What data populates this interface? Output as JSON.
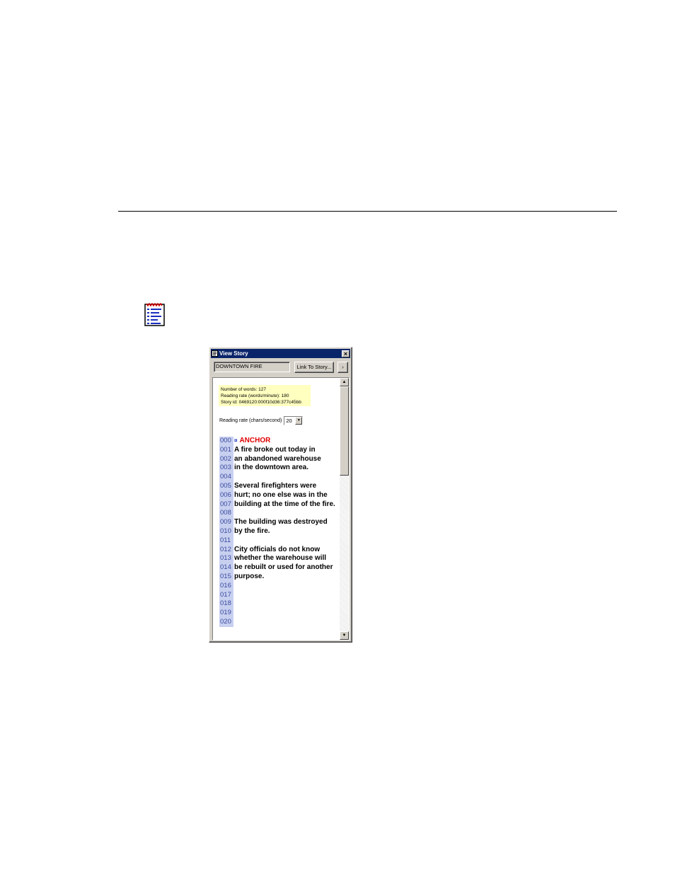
{
  "window": {
    "title": "View Story",
    "close_label": "×",
    "slug": "DOWNTOWN FIRE",
    "link_button": "Link To Story...",
    "next_button": "›"
  },
  "info": {
    "words": "Number of words: 127",
    "rate": "Reading rate (words/minute): 180",
    "story_id": "Story id: 0469120:000f10d36:377c45bb"
  },
  "reading_rate": {
    "label": "Reading rate (chars/second)",
    "value": "20"
  },
  "script": {
    "lines": [
      {
        "num": "000",
        "text": "ANCHOR",
        "cue": "¤",
        "anchor": true
      },
      {
        "num": "001",
        "text": "A fire broke out today in"
      },
      {
        "num": "002",
        "text": "an abandoned warehouse"
      },
      {
        "num": "003",
        "text": "in the downtown area."
      },
      {
        "num": "004",
        "text": ""
      },
      {
        "num": "005",
        "text": "Several firefighters were"
      },
      {
        "num": "006",
        "text": "hurt; no one else was in the"
      },
      {
        "num": "007",
        "text": "building at the time of the fire."
      },
      {
        "num": "008",
        "text": ""
      },
      {
        "num": "009",
        "text": "The building was destroyed"
      },
      {
        "num": "010",
        "text": "by the fire."
      },
      {
        "num": "011",
        "text": ""
      },
      {
        "num": "012",
        "text": "City officials do not know"
      },
      {
        "num": "013",
        "text": "whether the warehouse will"
      },
      {
        "num": "014",
        "text": "be rebuilt or used for another"
      },
      {
        "num": "015",
        "text": "purpose."
      },
      {
        "num": "016",
        "text": ""
      },
      {
        "num": "017",
        "text": ""
      },
      {
        "num": "018",
        "text": ""
      },
      {
        "num": "019",
        "text": ""
      },
      {
        "num": "020",
        "text": ""
      }
    ]
  },
  "icons": {
    "page_icon": "view-story-icon",
    "title_icon": "story-window-icon"
  },
  "colors": {
    "titlebar": "#0a246a",
    "anchor_text": "#e00000",
    "line_number_bg": "#c8d0f0",
    "info_bg": "#ffffc0"
  }
}
